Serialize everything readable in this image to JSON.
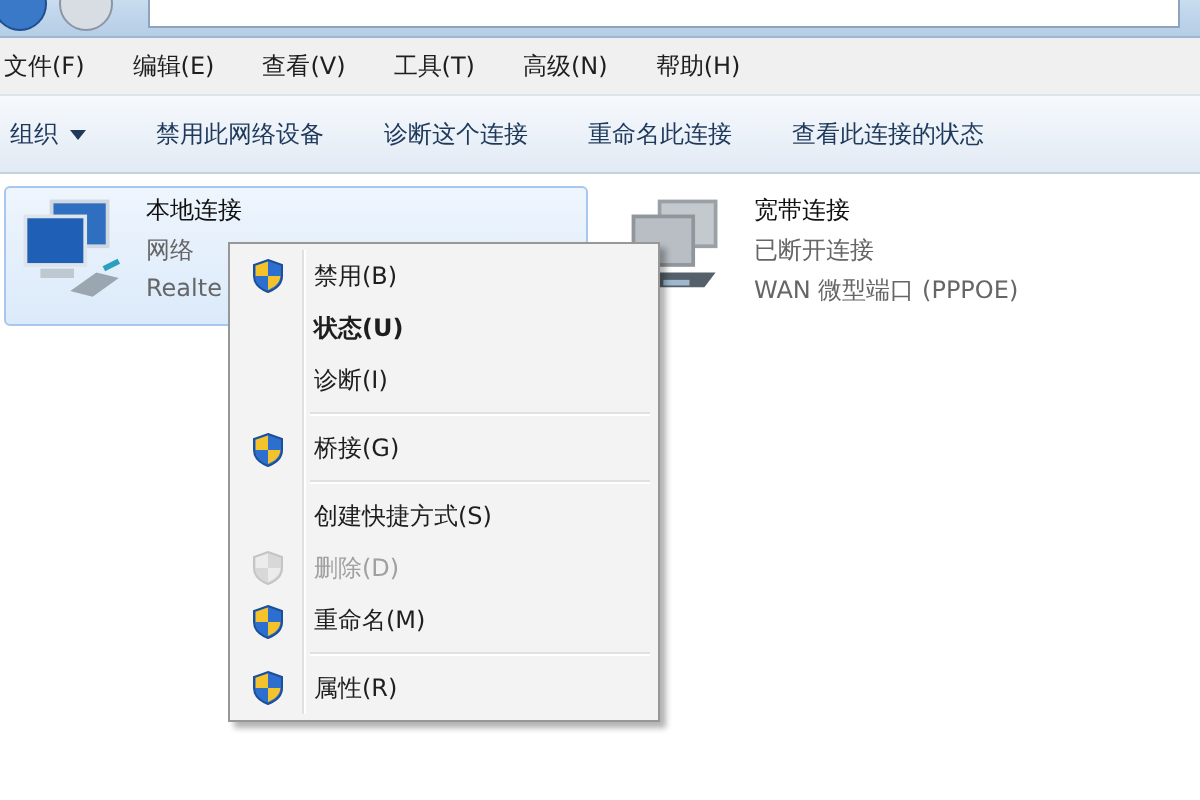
{
  "menu_bar": [
    {
      "label": "文件(F)"
    },
    {
      "label": "编辑(E)"
    },
    {
      "label": "查看(V)"
    },
    {
      "label": "工具(T)"
    },
    {
      "label": "高级(N)"
    },
    {
      "label": "帮助(H)"
    }
  ],
  "toolbar": [
    {
      "label": "组织",
      "dropdown": true
    },
    {
      "label": "禁用此网络设备",
      "dropdown": false
    },
    {
      "label": "诊断这个连接",
      "dropdown": false
    },
    {
      "label": "重命名此连接",
      "dropdown": false
    },
    {
      "label": "查看此连接的状态",
      "dropdown": false
    }
  ],
  "connections": [
    {
      "name": "本地连接",
      "status": "网络",
      "device": "Realte",
      "selected": true,
      "kind": "lan"
    },
    {
      "name": "宽带连接",
      "status": "已断开连接",
      "device": "WAN 微型端口 (PPPOE)",
      "selected": false,
      "kind": "wan"
    }
  ],
  "context_menu": [
    {
      "label": "禁用(B)",
      "shield": true,
      "bold": false,
      "disabled": false,
      "separator_after": false
    },
    {
      "label": "状态(U)",
      "shield": false,
      "bold": true,
      "disabled": false,
      "separator_after": false
    },
    {
      "label": "诊断(I)",
      "shield": false,
      "bold": false,
      "disabled": false,
      "separator_after": true
    },
    {
      "label": "桥接(G)",
      "shield": true,
      "bold": false,
      "disabled": false,
      "separator_after": true
    },
    {
      "label": "创建快捷方式(S)",
      "shield": false,
      "bold": false,
      "disabled": false,
      "separator_after": false
    },
    {
      "label": "删除(D)",
      "shield": true,
      "bold": false,
      "disabled": true,
      "separator_after": false
    },
    {
      "label": "重命名(M)",
      "shield": true,
      "bold": false,
      "disabled": false,
      "separator_after": true
    },
    {
      "label": "属性(R)",
      "shield": true,
      "bold": false,
      "disabled": false,
      "separator_after": false
    }
  ]
}
